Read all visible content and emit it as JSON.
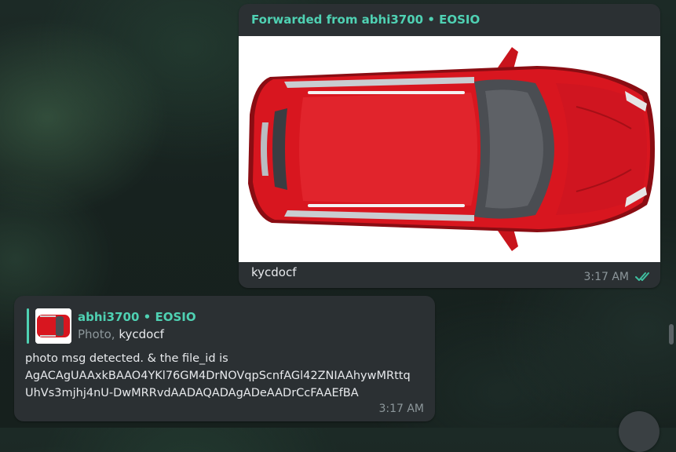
{
  "forwarded_message": {
    "header": "Forwarded from abhi3700 • EOSIO",
    "photo_icon": "red-car-top-view-image",
    "caption": "kycdocf",
    "time": "3:17 AM",
    "status_icon": "double-check-icon",
    "status_color": "#3fbfa0"
  },
  "reply_message": {
    "reply_to": {
      "author": "abhi3700 • EOSIO",
      "kind": "Photo,",
      "caption": "kycdocf"
    },
    "body_lines": [
      "photo msg detected. & the file_id is",
      "AgACAgUAAxkBAAO4YKl76GM4DrNOVqpScnfAGl42ZNIAAhywMRttq",
      "UhVs3mjhj4nU-DwMRRvdAADAQADAgADeAADrCcFAAEfBA"
    ],
    "time": "3:17 AM"
  },
  "colors": {
    "accent": "#4fd1b3",
    "bubble": "#2b3033",
    "muted": "#8d979b",
    "car_red": "#d8161f"
  }
}
